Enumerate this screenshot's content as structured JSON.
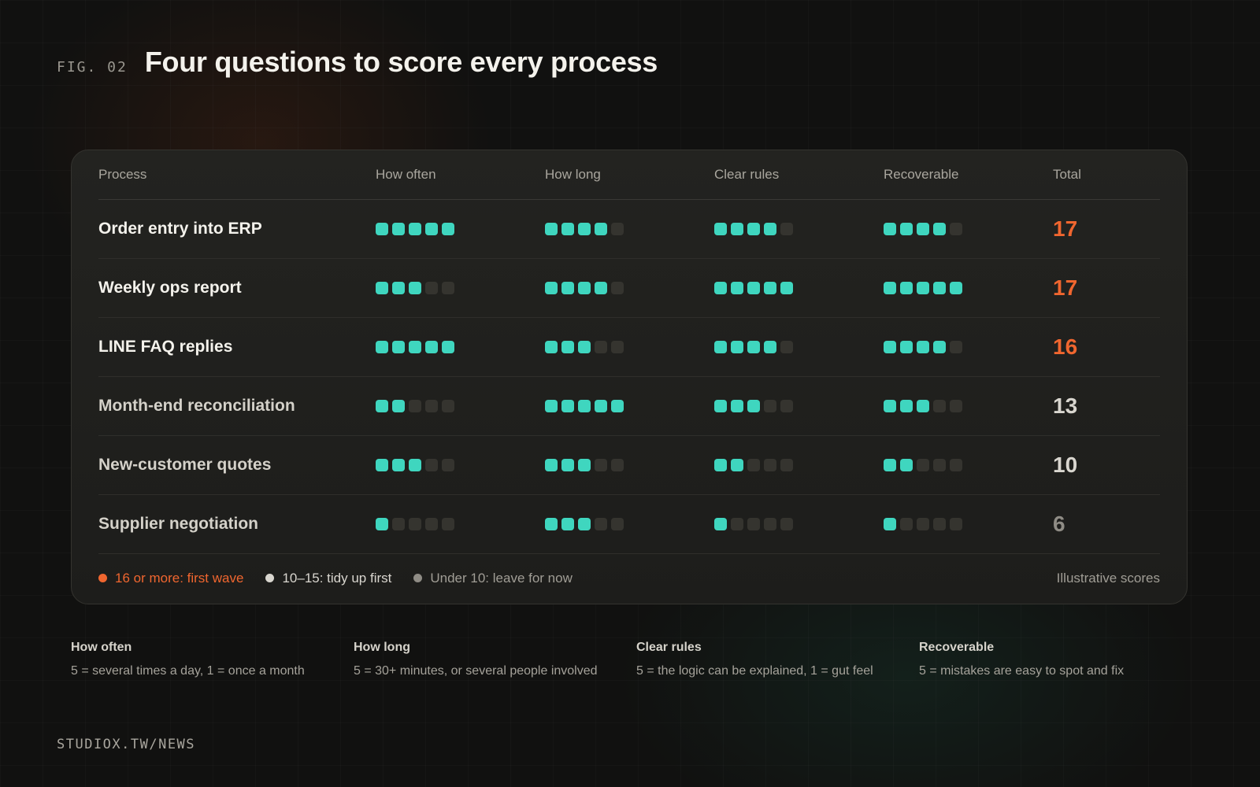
{
  "header": {
    "fig_label": "FIG. 02",
    "title": "Four questions to score every process"
  },
  "colors": {
    "accent_orange": "#f0662f",
    "score_teal": "#3fd6bf",
    "score_empty": "#35342f",
    "tier_high": "#f0662f",
    "tier_mid": "#d9d6cf",
    "tier_low": "#8f8c85"
  },
  "table": {
    "columns": [
      "Process",
      "How often",
      "How long",
      "Clear rules",
      "Recoverable",
      "Total"
    ],
    "max_score": 5,
    "rows": [
      {
        "process": "Order entry into ERP",
        "scores": [
          5,
          4,
          4,
          4
        ],
        "total": "17",
        "tier": "high"
      },
      {
        "process": "Weekly ops report",
        "scores": [
          3,
          4,
          5,
          5
        ],
        "total": "17",
        "tier": "high"
      },
      {
        "process": "LINE FAQ replies",
        "scores": [
          5,
          3,
          4,
          4
        ],
        "total": "16",
        "tier": "high"
      },
      {
        "process": "Month-end reconciliation",
        "scores": [
          2,
          5,
          3,
          3
        ],
        "total": "13",
        "tier": "mid"
      },
      {
        "process": "New-customer quotes",
        "scores": [
          3,
          3,
          2,
          2
        ],
        "total": "10",
        "tier": "mid"
      },
      {
        "process": "Supplier negotiation",
        "scores": [
          1,
          3,
          1,
          1
        ],
        "total": "6",
        "tier": "low"
      }
    ]
  },
  "legend": {
    "items": [
      {
        "label": "16 or more: first wave",
        "tier": "high"
      },
      {
        "label": "10–15: tidy up first",
        "tier": "mid"
      },
      {
        "label": "Under 10: leave for now",
        "tier": "low"
      }
    ],
    "note": "Illustrative scores"
  },
  "definitions": [
    {
      "title": "How often",
      "desc": "5 = several times a day, 1 = once a month"
    },
    {
      "title": "How long",
      "desc": "5 = 30+ minutes, or several people involved"
    },
    {
      "title": "Clear rules",
      "desc": "5 = the logic can be explained, 1 = gut feel"
    },
    {
      "title": "Recoverable",
      "desc": "5 = mistakes are easy to spot and fix"
    }
  ],
  "footer": {
    "text": "STUDIOX.TW/NEWS"
  }
}
